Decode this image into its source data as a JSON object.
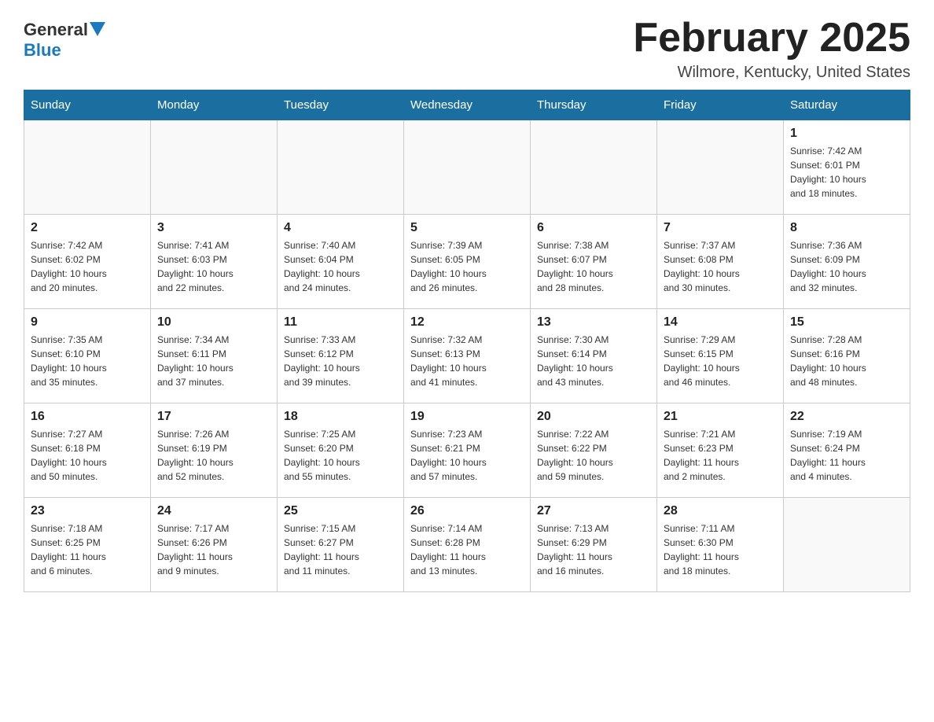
{
  "header": {
    "logo": {
      "general": "General",
      "blue": "Blue"
    },
    "title": "February 2025",
    "location": "Wilmore, Kentucky, United States"
  },
  "calendar": {
    "days_of_week": [
      "Sunday",
      "Monday",
      "Tuesday",
      "Wednesday",
      "Thursday",
      "Friday",
      "Saturday"
    ],
    "weeks": [
      {
        "days": [
          {
            "number": "",
            "info": ""
          },
          {
            "number": "",
            "info": ""
          },
          {
            "number": "",
            "info": ""
          },
          {
            "number": "",
            "info": ""
          },
          {
            "number": "",
            "info": ""
          },
          {
            "number": "",
            "info": ""
          },
          {
            "number": "1",
            "info": "Sunrise: 7:42 AM\nSunset: 6:01 PM\nDaylight: 10 hours\nand 18 minutes."
          }
        ]
      },
      {
        "days": [
          {
            "number": "2",
            "info": "Sunrise: 7:42 AM\nSunset: 6:02 PM\nDaylight: 10 hours\nand 20 minutes."
          },
          {
            "number": "3",
            "info": "Sunrise: 7:41 AM\nSunset: 6:03 PM\nDaylight: 10 hours\nand 22 minutes."
          },
          {
            "number": "4",
            "info": "Sunrise: 7:40 AM\nSunset: 6:04 PM\nDaylight: 10 hours\nand 24 minutes."
          },
          {
            "number": "5",
            "info": "Sunrise: 7:39 AM\nSunset: 6:05 PM\nDaylight: 10 hours\nand 26 minutes."
          },
          {
            "number": "6",
            "info": "Sunrise: 7:38 AM\nSunset: 6:07 PM\nDaylight: 10 hours\nand 28 minutes."
          },
          {
            "number": "7",
            "info": "Sunrise: 7:37 AM\nSunset: 6:08 PM\nDaylight: 10 hours\nand 30 minutes."
          },
          {
            "number": "8",
            "info": "Sunrise: 7:36 AM\nSunset: 6:09 PM\nDaylight: 10 hours\nand 32 minutes."
          }
        ]
      },
      {
        "days": [
          {
            "number": "9",
            "info": "Sunrise: 7:35 AM\nSunset: 6:10 PM\nDaylight: 10 hours\nand 35 minutes."
          },
          {
            "number": "10",
            "info": "Sunrise: 7:34 AM\nSunset: 6:11 PM\nDaylight: 10 hours\nand 37 minutes."
          },
          {
            "number": "11",
            "info": "Sunrise: 7:33 AM\nSunset: 6:12 PM\nDaylight: 10 hours\nand 39 minutes."
          },
          {
            "number": "12",
            "info": "Sunrise: 7:32 AM\nSunset: 6:13 PM\nDaylight: 10 hours\nand 41 minutes."
          },
          {
            "number": "13",
            "info": "Sunrise: 7:30 AM\nSunset: 6:14 PM\nDaylight: 10 hours\nand 43 minutes."
          },
          {
            "number": "14",
            "info": "Sunrise: 7:29 AM\nSunset: 6:15 PM\nDaylight: 10 hours\nand 46 minutes."
          },
          {
            "number": "15",
            "info": "Sunrise: 7:28 AM\nSunset: 6:16 PM\nDaylight: 10 hours\nand 48 minutes."
          }
        ]
      },
      {
        "days": [
          {
            "number": "16",
            "info": "Sunrise: 7:27 AM\nSunset: 6:18 PM\nDaylight: 10 hours\nand 50 minutes."
          },
          {
            "number": "17",
            "info": "Sunrise: 7:26 AM\nSunset: 6:19 PM\nDaylight: 10 hours\nand 52 minutes."
          },
          {
            "number": "18",
            "info": "Sunrise: 7:25 AM\nSunset: 6:20 PM\nDaylight: 10 hours\nand 55 minutes."
          },
          {
            "number": "19",
            "info": "Sunrise: 7:23 AM\nSunset: 6:21 PM\nDaylight: 10 hours\nand 57 minutes."
          },
          {
            "number": "20",
            "info": "Sunrise: 7:22 AM\nSunset: 6:22 PM\nDaylight: 10 hours\nand 59 minutes."
          },
          {
            "number": "21",
            "info": "Sunrise: 7:21 AM\nSunset: 6:23 PM\nDaylight: 11 hours\nand 2 minutes."
          },
          {
            "number": "22",
            "info": "Sunrise: 7:19 AM\nSunset: 6:24 PM\nDaylight: 11 hours\nand 4 minutes."
          }
        ]
      },
      {
        "days": [
          {
            "number": "23",
            "info": "Sunrise: 7:18 AM\nSunset: 6:25 PM\nDaylight: 11 hours\nand 6 minutes."
          },
          {
            "number": "24",
            "info": "Sunrise: 7:17 AM\nSunset: 6:26 PM\nDaylight: 11 hours\nand 9 minutes."
          },
          {
            "number": "25",
            "info": "Sunrise: 7:15 AM\nSunset: 6:27 PM\nDaylight: 11 hours\nand 11 minutes."
          },
          {
            "number": "26",
            "info": "Sunrise: 7:14 AM\nSunset: 6:28 PM\nDaylight: 11 hours\nand 13 minutes."
          },
          {
            "number": "27",
            "info": "Sunrise: 7:13 AM\nSunset: 6:29 PM\nDaylight: 11 hours\nand 16 minutes."
          },
          {
            "number": "28",
            "info": "Sunrise: 7:11 AM\nSunset: 6:30 PM\nDaylight: 11 hours\nand 18 minutes."
          },
          {
            "number": "",
            "info": ""
          }
        ]
      }
    ]
  }
}
